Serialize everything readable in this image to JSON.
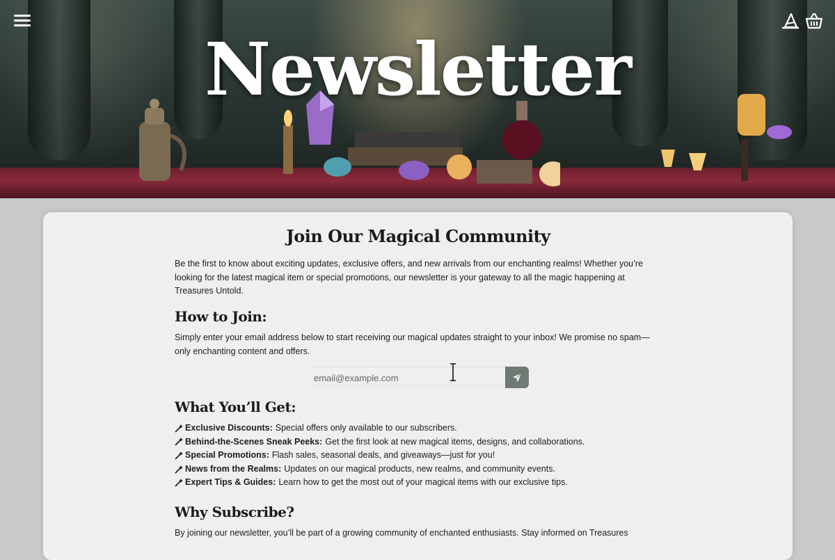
{
  "header": {
    "title": "Newsletter",
    "icons": [
      "menu-icon",
      "wizard-hat-icon",
      "basket-icon"
    ]
  },
  "card": {
    "title": "Join Our Magical Community",
    "intro": "Be the first to know about exciting updates, exclusive offers, and new arrivals from our enchanting realms! Whether you’re looking for the latest magical item or special promotions, our newsletter is your gateway to all the magic happening at Treasures Untold.",
    "how_to_join": {
      "heading": "How to Join:",
      "text": "Simply enter your email address below to start receiving our magical updates straight to your inbox! We promise no spam—only enchanting content and offers."
    },
    "form": {
      "email_placeholder": "email@example.com",
      "submit_icon": "paper-plane-icon"
    },
    "benefits": {
      "heading": "What You’ll Get:",
      "items": [
        {
          "label": "Exclusive Discounts:",
          "text": "Special offers only available to our subscribers."
        },
        {
          "label": "Behind-the-Scenes Sneak Peeks:",
          "text": "Get the first look at new magical items, designs, and collaborations."
        },
        {
          "label": "Special Promotions:",
          "text": "Flash sales, seasonal deals, and giveaways—just for you!"
        },
        {
          "label": "News from the Realms:",
          "text": "Updates on our magical products, new realms, and community events."
        },
        {
          "label": "Expert Tips & Guides:",
          "text": "Learn how to get the most out of your magical items with our exclusive tips."
        }
      ]
    },
    "why": {
      "heading": "Why Subscribe?",
      "text": "By joining our newsletter, you’ll be part of a growing community of enchanted enthusiasts. Stay informed on Treasures"
    }
  },
  "colors": {
    "accent": "#6f7a73",
    "card_bg": "#efefef",
    "page_bg": "#c9c9c9",
    "table_red": "#8a2a3a"
  }
}
